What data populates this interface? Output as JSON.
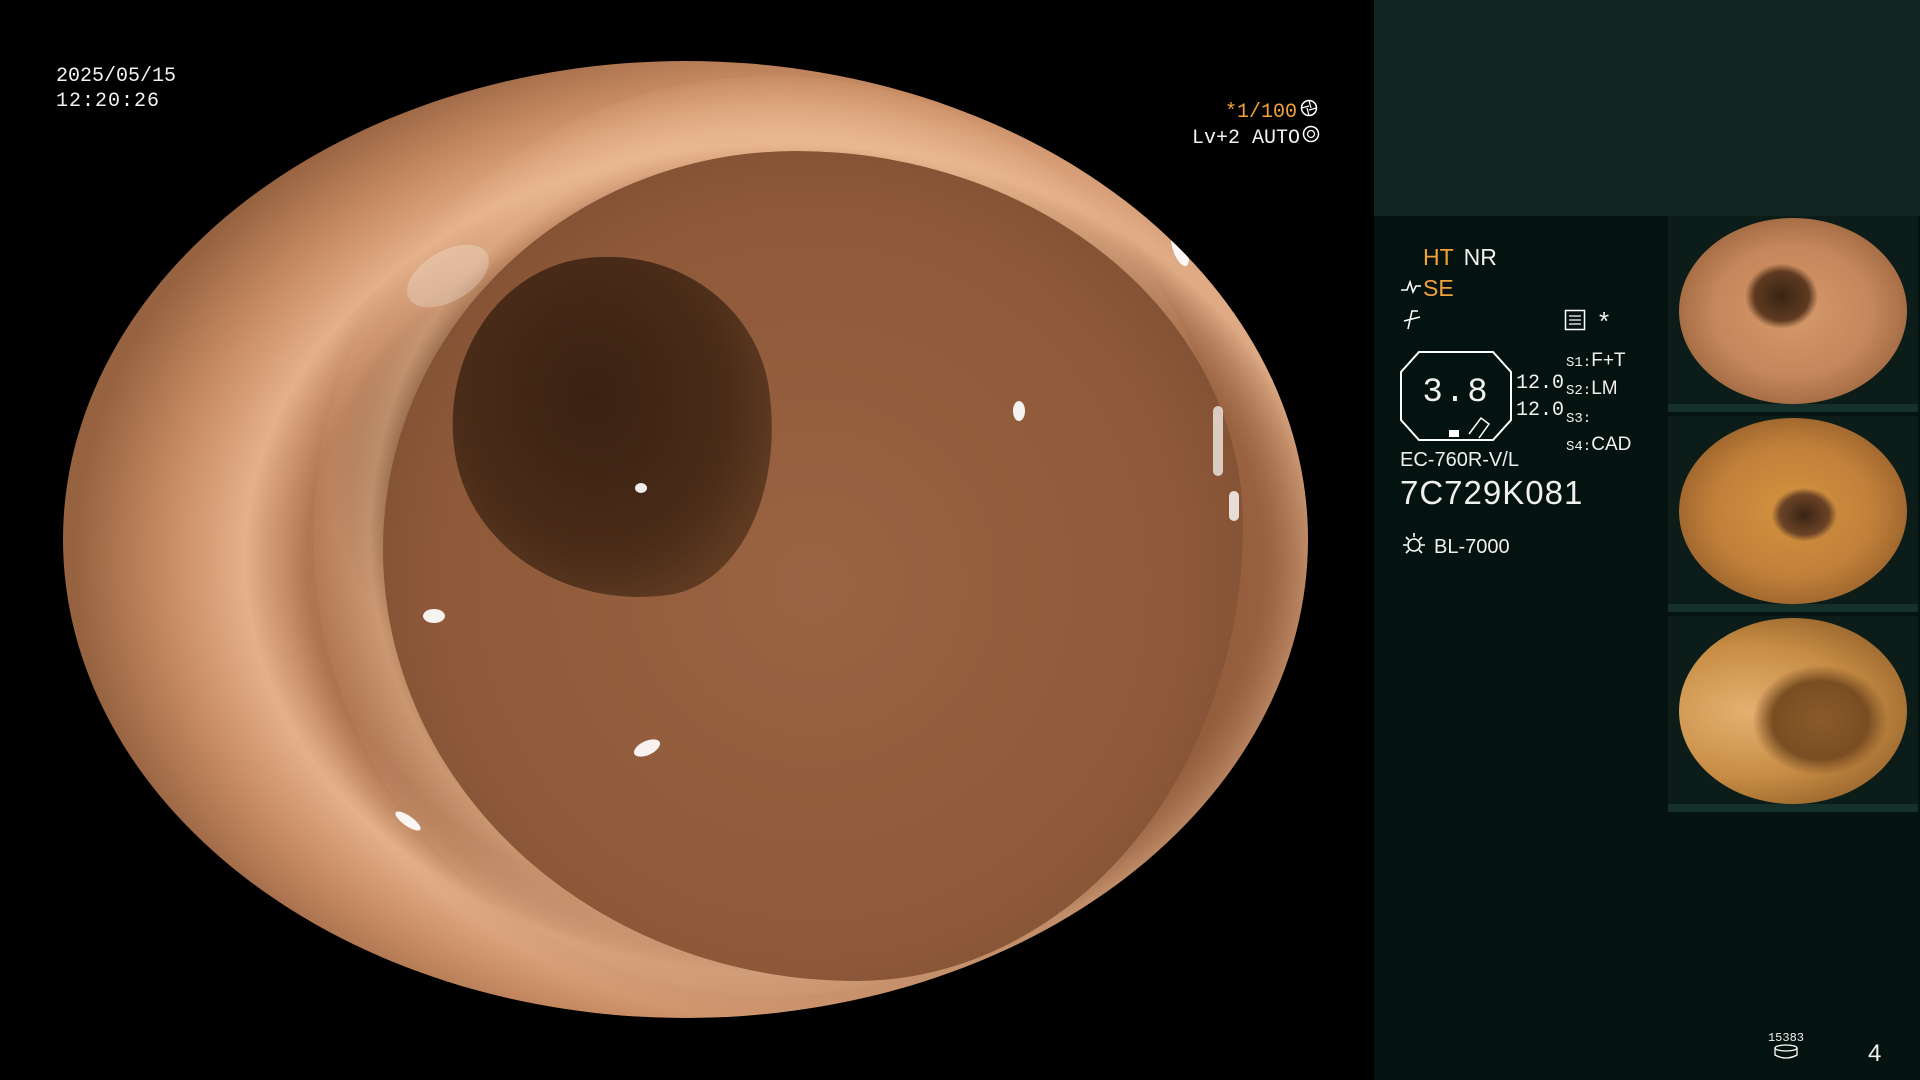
{
  "overlay": {
    "date": "2025/05/15",
    "time": "12:20:26",
    "shutter": "*1/100",
    "level": "Lv+2",
    "mode": "AUTO"
  },
  "panel": {
    "ht": "HT",
    "nr": "NR",
    "se": "SE",
    "asterisk": "*",
    "zoom_value": "3.8",
    "value_top": "12.0",
    "value_bottom": "12.0",
    "s1_label": "S1:",
    "s1_value": "F+T",
    "s2_label": "S2:",
    "s2_value": "LM",
    "s3_label": "S3:",
    "s3_value": "",
    "s4_label": "S4:",
    "s4_value": "CAD",
    "scope_model": "EC-760R-V/L",
    "serial": "7C729K081",
    "light_source": "BL-7000",
    "storage_count": "15383",
    "image_count": "4"
  },
  "colors": {
    "accent_orange": "#f2a23a",
    "panel_bg": "#051310",
    "panel_top_bg": "#0f2522"
  },
  "icons": [
    "aperture-icon",
    "gear-icon",
    "curve-icon",
    "filter-icon",
    "image-list-icon",
    "light-source-icon",
    "disk-icon"
  ]
}
